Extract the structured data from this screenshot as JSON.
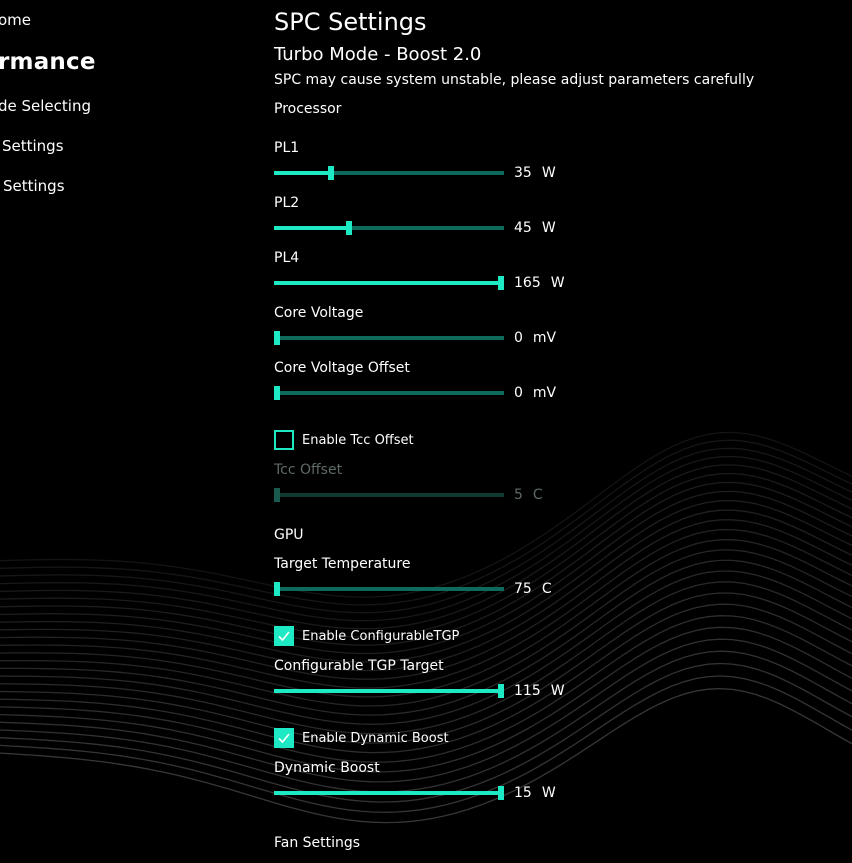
{
  "nav": {
    "items": [
      {
        "label": "ome",
        "active": false
      },
      {
        "label": "rmance",
        "active": true
      },
      {
        "label": "de Selecting",
        "active": false
      },
      {
        "label": "Settings",
        "active": false
      },
      {
        "label": "Settings",
        "active": false
      }
    ]
  },
  "panel": {
    "title": "SPC Settings",
    "subtitle": "Turbo Mode - Boost 2.0",
    "warning": "SPC may cause system unstable, please adjust parameters carefully",
    "processor_label": "Processor",
    "gpu_label": "GPU",
    "fan_label": "Fan Settings"
  },
  "sliders": {
    "pl1": {
      "label": "PL1",
      "value": "35",
      "unit": "W",
      "fraction": 0.24
    },
    "pl2": {
      "label": "PL2",
      "value": "45",
      "unit": "W",
      "fraction": 0.32
    },
    "pl4": {
      "label": "PL4",
      "value": "165",
      "unit": "W",
      "fraction": 1.0
    },
    "core_voltage": {
      "label": "Core Voltage",
      "value": "0",
      "unit": "mV",
      "fraction": 0.0
    },
    "core_voltage_offset": {
      "label": "Core Voltage Offset",
      "value": "0",
      "unit": "mV",
      "fraction": 0.0
    },
    "tcc_offset": {
      "label": "Tcc Offset",
      "value": "5",
      "unit": "C",
      "fraction": 0.0
    },
    "target_temperature": {
      "label": "Target Temperature",
      "value": "75",
      "unit": "C",
      "fraction": 0.0
    },
    "tgp_target": {
      "label": "Configurable TGP Target",
      "value": "115",
      "unit": "W",
      "fraction": 1.0
    },
    "dynamic_boost": {
      "label": "Dynamic Boost",
      "value": "15",
      "unit": "W",
      "fraction": 1.0
    }
  },
  "checkboxes": {
    "tcc_offset": {
      "label": "Enable Tcc Offset",
      "checked": false
    },
    "configurable_tgp": {
      "label": "Enable ConfigurableTGP",
      "checked": true
    },
    "dynamic_boost": {
      "label": "Enable Dynamic Boost",
      "checked": true
    }
  },
  "colors": {
    "accent": "#1de9c4",
    "track": "#0e6b5b",
    "background": "#000000",
    "disabled_text": "#5e6a67"
  }
}
